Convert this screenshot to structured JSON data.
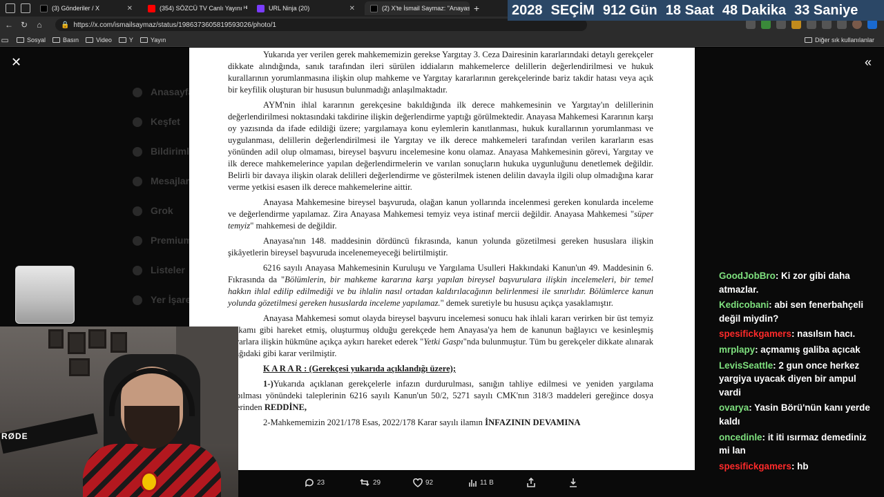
{
  "browser": {
    "tabs": [
      {
        "title": "(3) Gönderiler / X",
        "favicon_color": "#000000"
      },
      {
        "title": "(354) SÖZCÜ TV Canlı Yayını ᴴᴰ - Y",
        "favicon_color": "#ff0000"
      },
      {
        "title": "URL Ninja (20)",
        "favicon_color": "#7a3cff"
      },
      {
        "title": "(2) X'te İsmail Saymaz: \"Anayasa M",
        "favicon_color": "#000000"
      }
    ],
    "new_tab": "+",
    "url": "https://x.com/ismailsaymaz/status/1986373605819593026/photo/1",
    "bookmarks": [
      "Sosyal",
      "Basın",
      "Video",
      "Y",
      "Yayın"
    ],
    "bookmarks_right": "Diğer sık kullanılanlar"
  },
  "countdown": {
    "year": "2028",
    "label": "SEÇİM",
    "days": "912 Gün",
    "hours": "18 Saat",
    "minutes": "48 Dakika",
    "seconds": "33 Saniye",
    "bg_color": "#2b4766"
  },
  "background_nav": [
    "Anasayfa",
    "Keşfet",
    "Bildirimler",
    "Mesajlar",
    "Grok",
    "Premium",
    "Listeler",
    "Yer İşaretleri"
  ],
  "document": {
    "p1": "Yukarıda yer verilen gerek mahkememizin gerekse Yargıtay 3. Ceza Dairesinin kararlarındaki detaylı gerekçeler dikkate alındığında, sanık tarafından ileri sürülen iddiaların mahkemelerce delillerin değerlendirilmesi ve hukuk kurallarının yorumlanmasına ilişkin olup mahkeme ve Yargıtay kararlarının gerekçelerinde bariz takdir hatası veya açık bir keyfilik oluşturan bir hususun bulunmadığı anlaşılmaktadır.",
    "p2": "AYM'nin ihlal kararının gerekçesine bakıldığında ilk derece mahkemesinin ve Yargıtay'ın delillerinin değerlendirilmesi noktasındaki takdirine ilişkin değerlendirme yaptığı görülmektedir. Anayasa Mahkemesi Kararının karşı oy yazısında da ifade edildiği üzere; yargılamaya konu eylemlerin kanıtlanması, hukuk kurallarının yorumlanması ve uygulanması, delillerin değerlendirilmesi ile Yargıtay ve ilk derece mahkemeleri tarafından verilen kararların esas yönünden adil olup olmaması, bireysel başvuru incelemesine konu olamaz. Anayasa Mahkemesinin görevi, Yargıtay ve ilk derece mahkemelerince yapılan değerlendirmelerin ve varılan sonuçların hukuka uygunluğunu denetlemek değildir. Belirli bir davaya ilişkin olarak delilleri değerlendirme ve gösterilmek istenen delilin davayla ilgili olup olmadığına karar verme yetkisi esasen ilk derece mahkemelerine aittir.",
    "p3_a": "Anayasa Mahkemesine bireysel başvuruda, olağan kanun yollarında incelenmesi gereken konularda inceleme ve değerlendirme yapılamaz. Zira Anayasa Mahkemesi temyiz veya istinaf mercii değildir. Anayasa Mahkemesi \"",
    "p3_em": "süper temyiz",
    "p3_b": "\" mahkemesi de değildir.",
    "p4": "Anayasa'nın 148. maddesinin dördüncü fıkrasında, kanun yolunda gözetilmesi gereken hususlara ilişkin şikâyetlerin bireysel başvuruda incelenemeyeceği belirtilmiştir.",
    "p5_a": "6216 sayılı Anayasa Mahkemesinin Kuruluşu ve Yargılama Usulleri Hakkındaki Kanun'un 49. Maddesinin 6. Fıkrasında da \"",
    "p5_em": "Bölümlerin, bir mahkeme kararına karşı yapılan bireysel başvurulara ilişkin incelemeleri, bir temel hakkın ihlal edilip edilmediği ve bu ihlalin nasıl ortadan kaldırılacağının belirlenmesi ile sınırlıdır. Bölümlerce kanun yolunda gözetilmesi gereken hususlarda inceleme yapılamaz.",
    "p5_b": "\" demek suretiyle bu hususu açıkça yasaklamıştır.",
    "p6_a": "Anayasa Mahkemesi somut olayda bireysel başvuru incelemesi sonucu hak ihlali kararı verirken bir üst temyiz makamı gibi hareket etmiş, oluşturmuş olduğu gerekçede hem Anayasa'ya hem de kanunun bağlayıcı ve kesinleşmiş kararlara ilişkin hükmüne açıkça aykırı hareket ederek \"",
    "p6_em": "Yetki Gaspı",
    "p6_b": "\"nda bulunmuştur. Tüm bu gerekçeler dikkate alınarak aşağıdaki gibi karar verilmiştir.",
    "karar": "K A R A R : (Gerekçesi yukarıda açıklandığı üzere);",
    "d1_num": "1-)",
    "d1_text": "Yukarıda açıklanan gerekçelerle infazın durdurulması, sanığın tahliye edilmesi ve yeniden yargılama yapılması yönündeki taleplerinin 6216 sayılı Kanun'un 50/2, 5271 sayılı CMK'nın 318/3 maddeleri gereğince dosya üzerinden ",
    "d1_bold": "REDDİNE,",
    "d2_text": "2-Mahkememizin 2021/178 Esas, 2022/178 Karar sayılı ilamın ",
    "d2_bold": "İNFAZININ DEVAMINA"
  },
  "actions": {
    "replies": "23",
    "reposts": "29",
    "likes": "92",
    "views": "11 B"
  },
  "webcam": {
    "mic_brand": "RØDE"
  },
  "chat": [
    {
      "user": "GoodJobBro",
      "color": "#7ee07e",
      "text": "Ki zor gibi daha atmazlar."
    },
    {
      "user": "Kedicobani",
      "color": "#7ee07e",
      "text": "abi sen fenerbahçeli değil miydin?"
    },
    {
      "user": "spesifickgamers",
      "color": "#ff2a2a",
      "text": "nasılsın hacı."
    },
    {
      "user": "mrplapy",
      "color": "#7ee07e",
      "text": "açmamış galiba açıcak"
    },
    {
      "user": "LevisSeattle",
      "color": "#7ee07e",
      "text": "2 gun once herkez yargiya uyacak diyen bir ampul vardi"
    },
    {
      "user": "ovarya",
      "color": "#7ee07e",
      "text": "Yasin Börü'nün kanı yerde kaldı"
    },
    {
      "user": "oncedinle",
      "color": "#7ee07e",
      "text": "it iti ısırmaz demediniz mi lan"
    },
    {
      "user": "spesifickgamers",
      "color": "#ff2a2a",
      "text": "hb"
    }
  ]
}
